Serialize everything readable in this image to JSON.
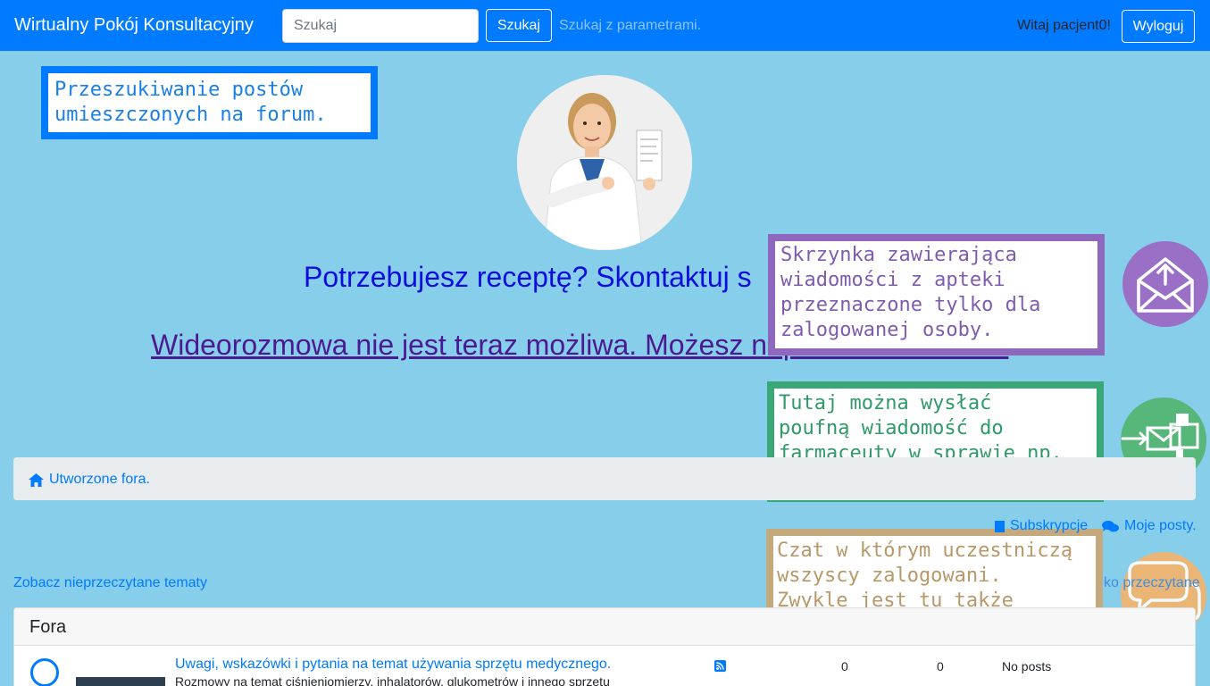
{
  "navbar": {
    "brand": "Wirtualny Pokój Konsultacyjny",
    "search_placeholder": "Szukaj",
    "search_button": "Szukaj",
    "advanced_search": "Szukaj z parametrami.",
    "greeting": "Witaj pacjent0!",
    "logout_button": "Wyloguj"
  },
  "hero": {
    "title": "Potrzebujesz receptę? Skontaktuj s",
    "video_link": "Wideorozmowa nie jest teraz możliwa. Możesz napisać wiadomość."
  },
  "tooltips": {
    "search": "Przeszukiwanie postów\numieszczonych na forum.",
    "inbox": "Skrzynka zawierająca\nwiadomości z apteki\nprzeznaczone tylko dla\nzalogowanej osoby.",
    "message": "Tutaj można wysłać\npoufną wiadomość do\nfarmaceuty w sprawie np.\nwypisania recepty.",
    "chat": "Czat w którym uczestniczą\nwszyscy zalogowani.\nZwykle jest tu także\npracownik apteki."
  },
  "breadcrumb": {
    "home_label": "Utworzone fora."
  },
  "actions": {
    "subscriptions": "Subskrypcje",
    "my_posts": "Moje posty.",
    "unread_topics": "Zobacz nieprzeczytane tematy",
    "mark_read": "ko przeczytane"
  },
  "forums": {
    "header": "Fora",
    "rows": [
      {
        "name": "Uwagi, wskazówki i pytania na temat używania sprzętu medycznego.",
        "description": "Rozmowy na temat ciśnieniomierzy, inhalatorów, glukometrów i innego sprzętu",
        "topics": "0",
        "posts": "0",
        "last_post": "No posts"
      }
    ]
  },
  "icons": {
    "inbox": "envelope-upload-icon",
    "message": "mail-send-icon",
    "chat": "chat-bubbles-icon"
  },
  "colors": {
    "primary": "#007bff",
    "page_bg": "#87ceeb",
    "inbox": "#9a6fc6",
    "message": "#57b67a",
    "chat": "#f6b36a"
  }
}
